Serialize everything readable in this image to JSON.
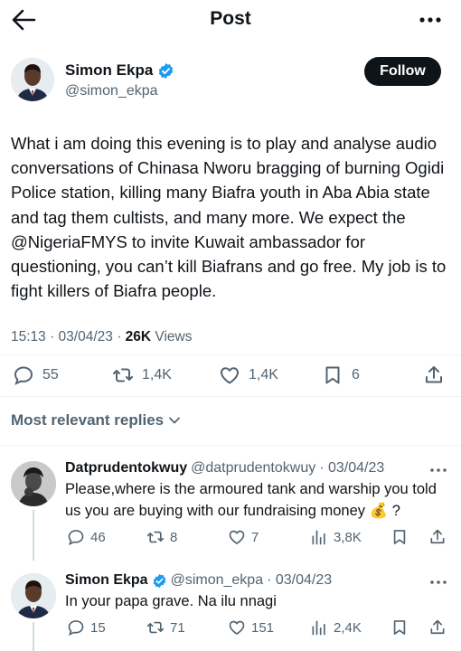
{
  "topbar": {
    "title": "Post"
  },
  "post": {
    "author_name": "Simon Ekpa",
    "author_handle": "@simon_ekpa",
    "follow_label": "Follow",
    "text": "What i am doing this evening is to play and analyse audio conversations of Chinasa Nworu bragging of burning Ogidi Police station, killing many Biafra youth in Aba Abia state and tag them cultists, and many more. We expect the @NigeriaFMYS to invite Kuwait ambassador for questioning, you can’t kill Biafrans and go free. My job is to fight killers of Biafra people.",
    "timestamp": "15:13 · 03/04/23 · ",
    "views_count": "26K",
    "views_label": " Views",
    "replies": "55",
    "reposts": "1,4K",
    "likes": "1,4K",
    "bookmarks": "6"
  },
  "replies_header": {
    "label": "Most relevant replies"
  },
  "replies": [
    {
      "name": "Datprudentokwuy",
      "handle": "@datprudentokwuy",
      "date": " · 03/04/23",
      "text": "Please,where is the armoured tank and warship you told us you are buying with our fundraising money 💰 ?",
      "replies": "46",
      "reposts": "8",
      "likes": "7",
      "views": "3,8K"
    },
    {
      "name": "Simon Ekpa",
      "handle": "@simon_ekpa",
      "date": " · 03/04/23",
      "text": "In your papa grave. Na ilu nnagi",
      "replies": "15",
      "reposts": "71",
      "likes": "151",
      "views": "2,4K"
    }
  ],
  "colors": {
    "verified": "#1d9bf0",
    "text": "#0f1419",
    "secondary": "#536471",
    "divider": "#eff3f4"
  }
}
